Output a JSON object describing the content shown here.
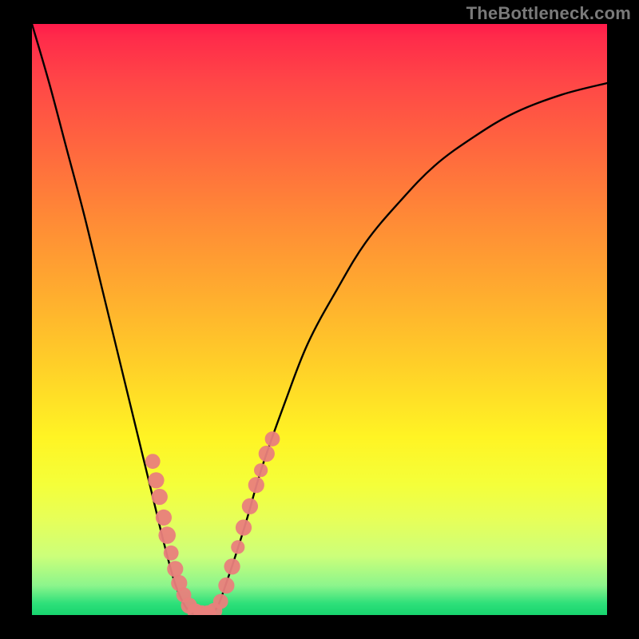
{
  "watermark": "TheBottleneck.com",
  "chart_data": {
    "type": "line",
    "title": "",
    "xlabel": "",
    "ylabel": "",
    "xlim": [
      0,
      100
    ],
    "ylim": [
      0,
      100
    ],
    "grid": false,
    "legend": false,
    "series": [
      {
        "name": "bottleneck-curve",
        "x": [
          0,
          3,
          6,
          9,
          12,
          15,
          18,
          21,
          23,
          25,
          27,
          29,
          30,
          32,
          34,
          37,
          40,
          44,
          48,
          53,
          58,
          64,
          70,
          77,
          84,
          92,
          100
        ],
        "y": [
          100,
          90,
          79,
          68,
          56,
          44,
          32,
          20,
          12,
          5,
          1,
          0,
          0,
          1,
          6,
          15,
          25,
          36,
          46,
          55,
          63,
          70,
          76,
          81,
          85,
          88,
          90
        ],
        "color": "#000000"
      }
    ],
    "markers": [
      {
        "name": "left-branch-dots",
        "color": "#e97f7c",
        "points": [
          {
            "x": 21.0,
            "y": 26.0,
            "r": 1.3
          },
          {
            "x": 21.6,
            "y": 22.8,
            "r": 1.4
          },
          {
            "x": 22.2,
            "y": 20.0,
            "r": 1.4
          },
          {
            "x": 22.9,
            "y": 16.5,
            "r": 1.4
          },
          {
            "x": 23.5,
            "y": 13.5,
            "r": 1.5
          },
          {
            "x": 24.2,
            "y": 10.5,
            "r": 1.3
          },
          {
            "x": 24.9,
            "y": 7.8,
            "r": 1.4
          },
          {
            "x": 25.6,
            "y": 5.4,
            "r": 1.4
          },
          {
            "x": 26.4,
            "y": 3.4,
            "r": 1.3
          }
        ]
      },
      {
        "name": "valley-dots",
        "color": "#e97f7c",
        "points": [
          {
            "x": 27.3,
            "y": 1.6,
            "r": 1.4
          },
          {
            "x": 28.4,
            "y": 0.6,
            "r": 1.4
          },
          {
            "x": 29.5,
            "y": 0.3,
            "r": 1.4
          },
          {
            "x": 30.6,
            "y": 0.3,
            "r": 1.4
          },
          {
            "x": 31.7,
            "y": 0.7,
            "r": 1.4
          }
        ]
      },
      {
        "name": "right-branch-dots",
        "color": "#e97f7c",
        "points": [
          {
            "x": 32.8,
            "y": 2.3,
            "r": 1.3
          },
          {
            "x": 33.8,
            "y": 5.0,
            "r": 1.4
          },
          {
            "x": 34.8,
            "y": 8.2,
            "r": 1.4
          },
          {
            "x": 35.8,
            "y": 11.5,
            "r": 1.2
          },
          {
            "x": 36.8,
            "y": 14.8,
            "r": 1.4
          },
          {
            "x": 37.9,
            "y": 18.4,
            "r": 1.4
          },
          {
            "x": 39.0,
            "y": 22.0,
            "r": 1.4
          },
          {
            "x": 39.8,
            "y": 24.5,
            "r": 1.2
          },
          {
            "x": 40.8,
            "y": 27.3,
            "r": 1.4
          },
          {
            "x": 41.8,
            "y": 29.8,
            "r": 1.3
          }
        ]
      }
    ]
  }
}
